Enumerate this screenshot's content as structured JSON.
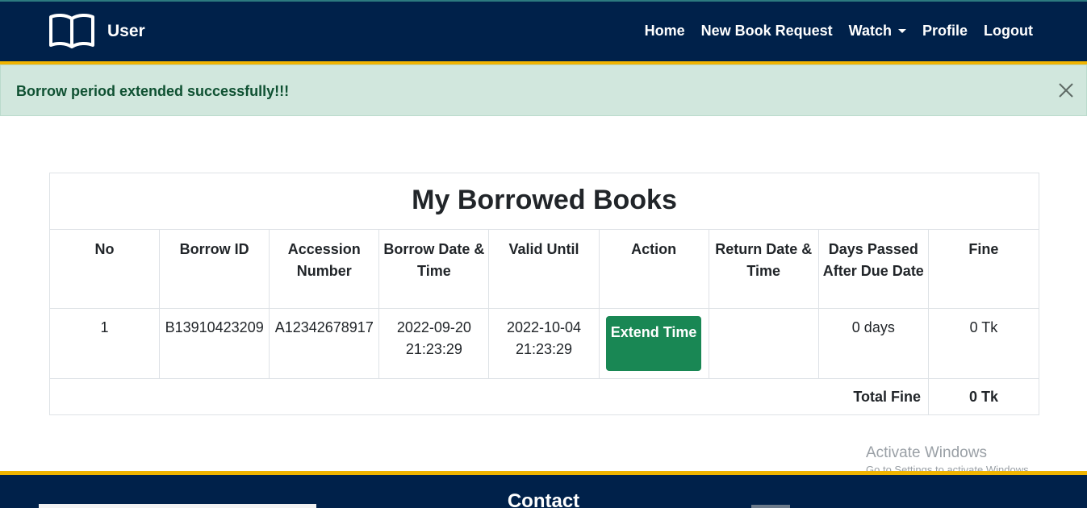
{
  "navbar": {
    "brand": "User",
    "brand_icon": "open-book-icon",
    "items": [
      {
        "label": "Home"
      },
      {
        "label": "New Book Request"
      },
      {
        "label": "Watch"
      },
      {
        "label": "Profile"
      },
      {
        "label": "Logout"
      }
    ]
  },
  "alert": {
    "message": "Borrow period extended successfully!!!",
    "close_icon": "close-icon"
  },
  "table": {
    "title": "My Borrowed Books",
    "headers": [
      "No",
      "Borrow ID",
      "Accession Number",
      "Borrow Date & Time",
      "Valid Until",
      "Action",
      "Return Date & Time",
      "Days Passed After Due Date",
      "Fine"
    ],
    "rows": [
      {
        "no": "1",
        "borrow_id": "B13910423209",
        "accession": "A12342678917",
        "borrow_date": "2022-09-20 21:23:29",
        "valid_until": "2022-10-04 21:23:29",
        "action_label": "Extend Time",
        "return_date": "",
        "days_passed": "0 days",
        "fine": "0 Tk"
      }
    ],
    "total_label": "Total Fine",
    "total_value": "0 Tk"
  },
  "watermark": {
    "title": "Activate Windows",
    "subtitle": "Go to Settings to activate Windows."
  },
  "footer": {
    "title": "Contact"
  },
  "colors": {
    "navbar_bg": "#00214a",
    "accent_yellow": "#f0b400",
    "alert_bg": "#d1e7dd",
    "alert_text": "#0f5132",
    "button_green": "#198754"
  }
}
